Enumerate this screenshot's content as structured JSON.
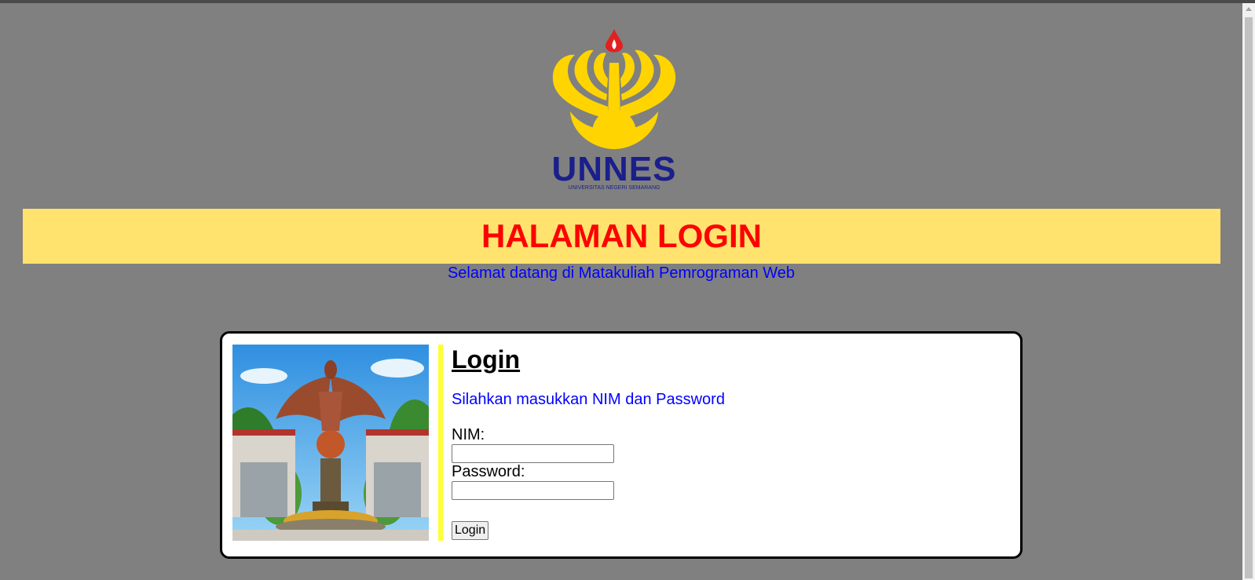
{
  "logo": {
    "brand": "UNNES",
    "subtitle": "UNIVERSITAS NEGERI SEMARANG"
  },
  "banner": {
    "title": "HALAMAN LOGIN"
  },
  "welcome": "Selamat datang di Matakuliah Pemrograman Web",
  "login": {
    "title": "Login",
    "instruction": "Silahkan masukkan NIM dan Password",
    "nim_label": "NIM:",
    "nim_value": "",
    "password_label": "Password:",
    "password_value": "",
    "button_label": "Login"
  },
  "colors": {
    "background": "#808080",
    "banner": "#ffe36e",
    "title": "#ff0000",
    "welcome": "#0000ff",
    "divider": "#ffff33",
    "logo_gold": "#ffd400",
    "logo_blue": "#1a1f8c"
  }
}
